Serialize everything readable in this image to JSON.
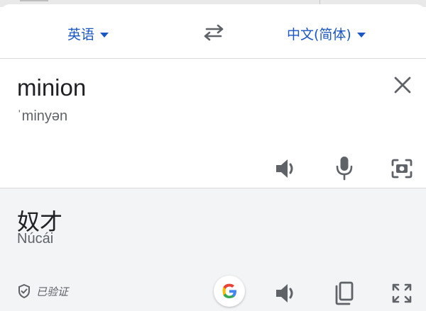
{
  "language_bar": {
    "source_language": "英语",
    "target_language": "中文(简体)"
  },
  "source": {
    "text": "minion",
    "phonetic": "ˈminyən"
  },
  "result": {
    "text": "奴才",
    "romanization": "Núcái",
    "verified_label": "已验证"
  },
  "icons": {
    "swap": "swap-arrows-icon",
    "clear": "close-icon",
    "source_speaker": "speaker-icon",
    "mic": "microphone-icon",
    "camera": "camera-translate-icon",
    "shield": "shield-check-icon",
    "google": "google-logo-icon",
    "result_speaker": "speaker-icon",
    "copy": "copy-icon",
    "fullscreen": "fullscreen-icon"
  },
  "colors": {
    "accent": "#1a56c4",
    "text": "#202124",
    "muted": "#5f6368",
    "icon": "#5f6368",
    "result_bg": "#f3f4f6"
  }
}
